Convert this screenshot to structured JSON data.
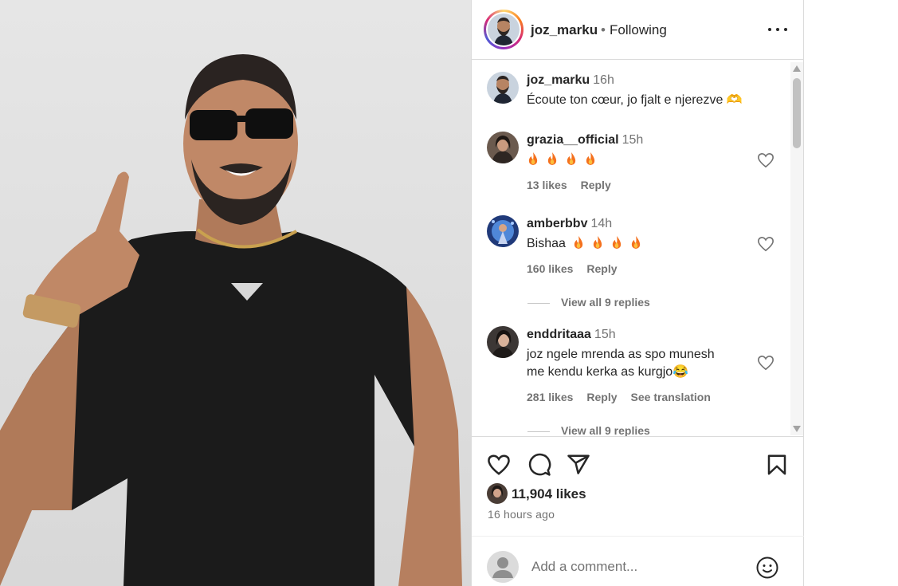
{
  "photo": {
    "icon": "post-photo-man-pointing-up"
  },
  "header": {
    "username": "joz_marku",
    "separator": "•",
    "follow_status": "Following",
    "more_icon": "more-horizontal-icon"
  },
  "caption": {
    "username": "joz_marku",
    "time": "16h",
    "text": "Écoute ton cœur, jo fjalt e njerezve 🫶"
  },
  "comments": [
    {
      "username": "grazia__official",
      "time": "15h",
      "text": "",
      "fires": 4,
      "likes": "13 likes",
      "reply": "Reply"
    },
    {
      "username": "amberbbv",
      "time": "14h",
      "text": "Bishaa",
      "fires": 4,
      "likes": "160 likes",
      "reply": "Reply",
      "view_replies": "View all 9 replies"
    },
    {
      "username": "enddritaaa",
      "time": "15h",
      "text_line1": "joz ngele mrenda as spo munesh",
      "text_line2": "me kendu kerka as kurgjo😂",
      "likes": "281 likes",
      "reply": "Reply",
      "translate": "See translation",
      "view_replies": "View all 9 replies"
    }
  ],
  "actions": {
    "like_icon": "heart-icon",
    "comment_icon": "comment-icon",
    "share_icon": "share-icon",
    "save_icon": "bookmark-icon",
    "likes_count": "11,904 likes",
    "time_ago": "16 hours ago"
  },
  "add_comment": {
    "placeholder": "Add a comment...",
    "emoji_icon": "emoji-icon"
  },
  "colors": {
    "text": "#262626",
    "muted": "#737373",
    "border": "#dbdbdb",
    "fire": "#f4711f"
  }
}
